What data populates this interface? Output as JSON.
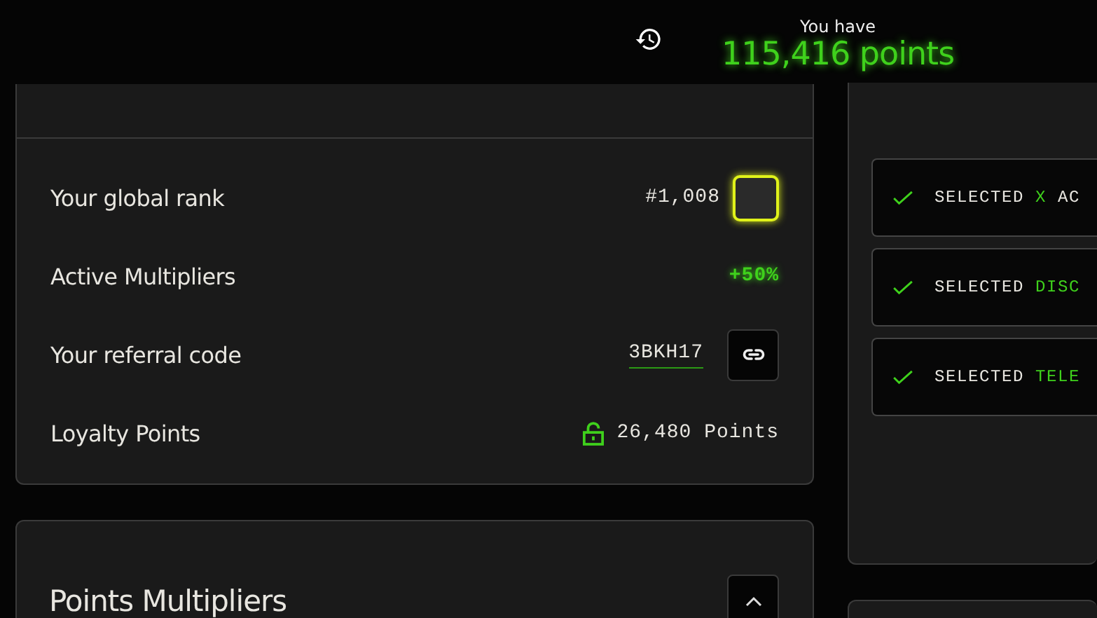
{
  "header": {
    "caption": "You have",
    "points": "115,416 points"
  },
  "stats": [
    {
      "kind": "rank",
      "label": "Your global rank",
      "value": "#1,008"
    },
    {
      "kind": "multiplier",
      "label": "Active Multipliers",
      "value": "+50%"
    },
    {
      "kind": "referral",
      "label": "Your referral code",
      "value": "3BKH17"
    },
    {
      "kind": "loyalty",
      "label": "Loyalty Points",
      "value": "26,480 Points"
    }
  ],
  "tasks": [
    {
      "label": "SELECTED",
      "highlight": "X",
      "rest": "AC",
      "done": true
    },
    {
      "label": "SELECTED",
      "highlight": "DISC",
      "done": true
    },
    {
      "label": "SELECTED",
      "highlight": "TELE",
      "done": true
    }
  ],
  "multipliers": {
    "title": "Points Multipliers",
    "expanded": true
  }
}
